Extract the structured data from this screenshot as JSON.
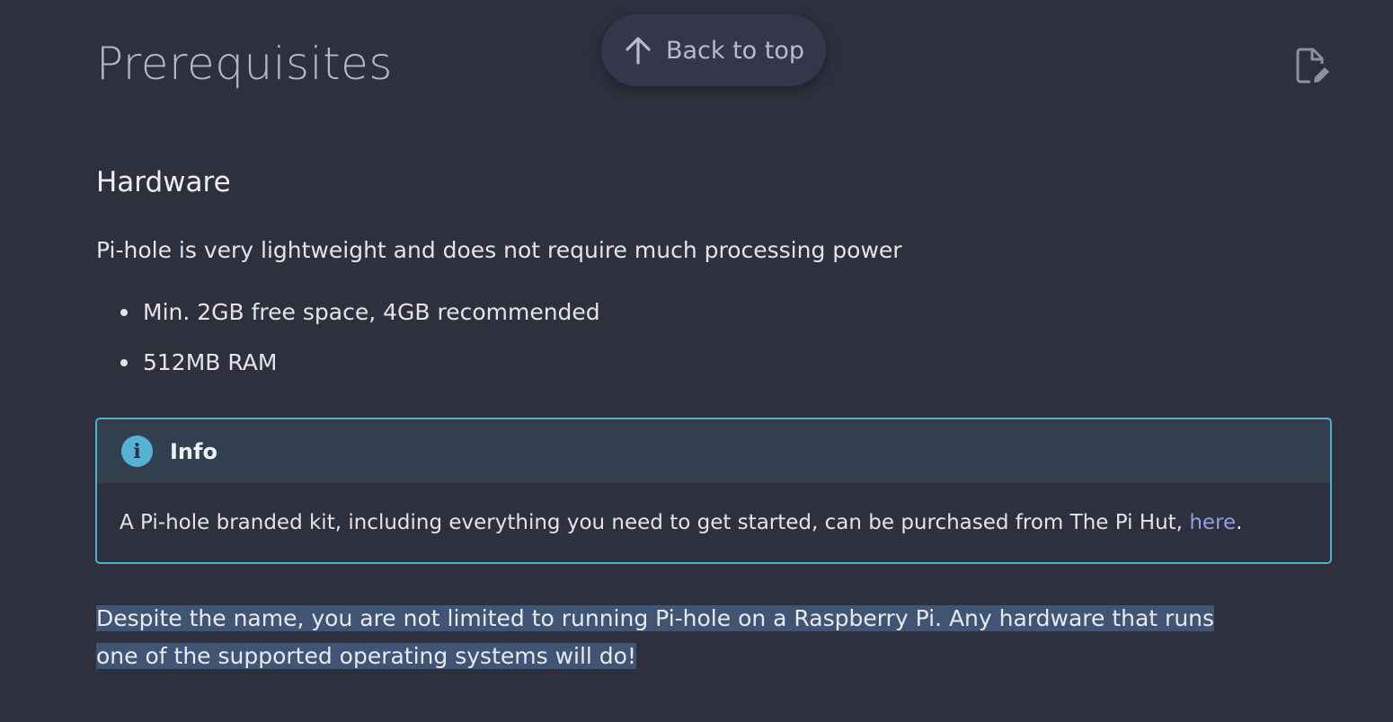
{
  "page": {
    "title": "Prerequisites"
  },
  "back_to_top": {
    "label": "Back to top",
    "icon": "arrow-up-icon"
  },
  "edit_button": {
    "icon": "edit-page-icon"
  },
  "hardware": {
    "heading": "Hardware",
    "intro": "Pi-hole is very lightweight and does not require much processing power",
    "requirements": [
      "Min. 2GB free space, 4GB recommended",
      "512MB RAM"
    ]
  },
  "info_box": {
    "title": "Info",
    "icon": "info-icon",
    "text_before_link": "A Pi-hole branded kit, including everything you need to get started, can be purchased from The Pi Hut, ",
    "link_text": "here",
    "text_after_link": "."
  },
  "note": {
    "text": "Despite the name, you are not limited to running Pi-hole on a Raspberry Pi. Any hardware that runs one of the supported operating systems will do!"
  },
  "colors": {
    "background": "#2e303e",
    "admonition_border": "#4fb2cd",
    "admonition_header": "#323f4e",
    "link": "#8aa3e0",
    "selection": "#405573"
  }
}
